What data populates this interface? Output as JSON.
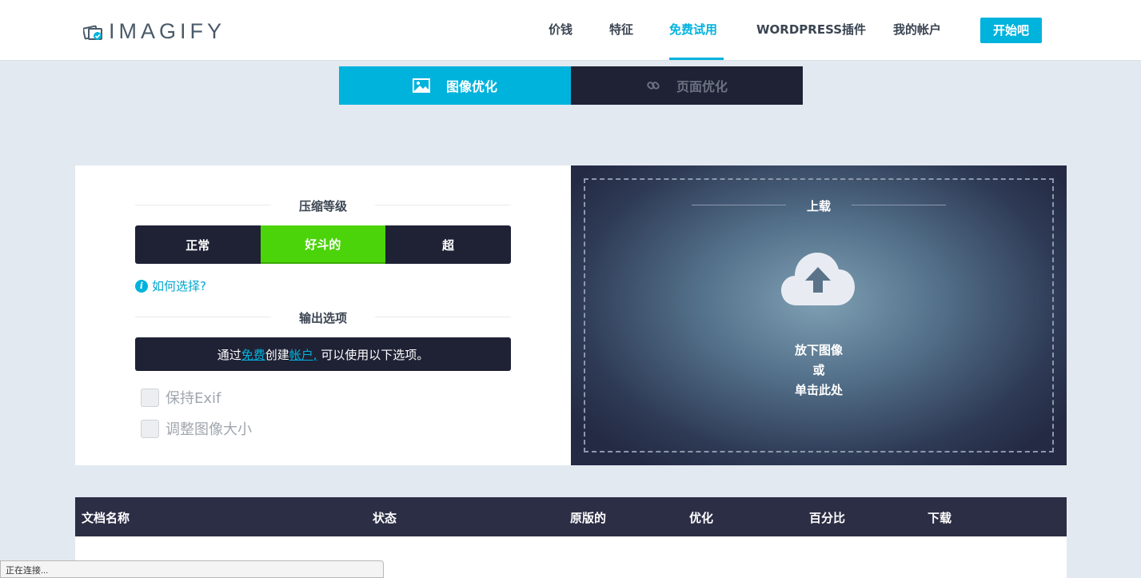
{
  "header": {
    "logo_text": "IMAGIFY",
    "nav": [
      "价钱",
      "特征",
      "免费试用",
      "WORDPRESS插件",
      "我的帐户"
    ],
    "active_nav": "免费试用",
    "start_button": "开始吧"
  },
  "tabs": {
    "image": "图像优化",
    "page": "页面优化"
  },
  "compression": {
    "title": "压缩等级",
    "levels": [
      "正常",
      "好斗的",
      "超"
    ],
    "selected": "好斗的",
    "help": "如何选择?"
  },
  "output": {
    "title": "输出选项",
    "notice_prefix": "通过",
    "notice_free": "免费",
    "notice_mid": "创建",
    "notice_account": "帐户,",
    "notice_suffix": " 可以使用以下选项。",
    "options": [
      "保持Exif",
      "调整图像大小"
    ]
  },
  "upload": {
    "title": "上载",
    "line1": "放下图像",
    "line2": "或",
    "line3": "单击此处"
  },
  "table": {
    "headers": [
      "文档名称",
      "状态",
      "原版的",
      "优化",
      "百分比",
      "下载"
    ]
  },
  "status_bar": "正在连接...",
  "colors": {
    "accent": "#00b3dd",
    "dark": "#1f2235",
    "selected_level": "#4cd40a"
  }
}
